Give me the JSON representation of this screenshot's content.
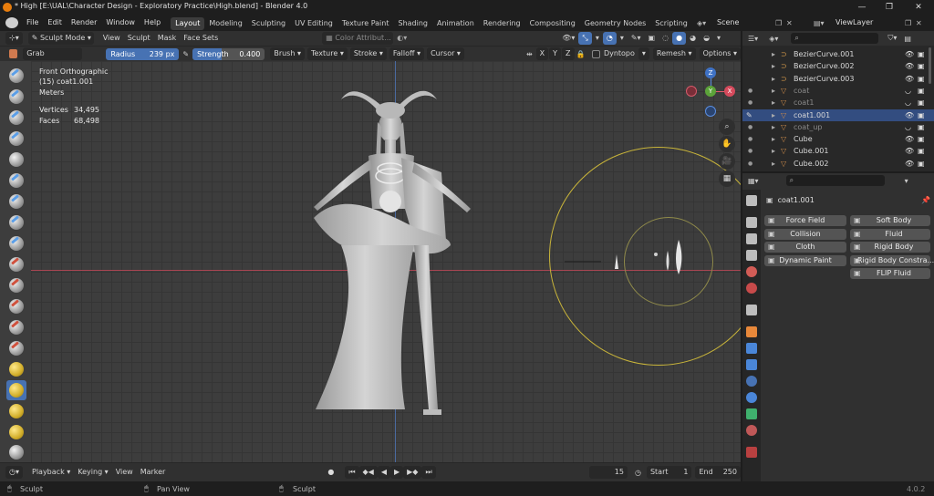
{
  "window": {
    "title": "* High [E:\\UAL\\Character Design - Exploratory Practice\\High.blend] - Blender 4.0",
    "minimize": "—",
    "maximize": "❐",
    "close": "✕"
  },
  "menu": [
    "File",
    "Edit",
    "Render",
    "Window",
    "Help"
  ],
  "workspaces": [
    "Layout",
    "Modeling",
    "Sculpting",
    "UV Editing",
    "Texture Paint",
    "Shading",
    "Animation",
    "Rendering",
    "Compositing",
    "Geometry Nodes",
    "Scripting"
  ],
  "active_workspace": "Layout",
  "scene": "Scene",
  "view_layer": "ViewLayer",
  "viewport_header": {
    "mode": "Sculpt Mode",
    "menus": [
      "View",
      "Sculpt",
      "Mask",
      "Face Sets"
    ],
    "color_attribute": "Color Attribut..."
  },
  "tool_settings": {
    "brush": "Grab",
    "radius_label": "Radius",
    "radius_value": "239 px",
    "strength_label": "Strength",
    "strength_value": "0.400",
    "menus": [
      "Brush",
      "Texture",
      "Stroke",
      "Falloff",
      "Cursor"
    ],
    "axes": [
      "X",
      "Y",
      "Z"
    ],
    "dyntopo": "Dyntopo",
    "remesh": "Remesh",
    "options": "Options"
  },
  "viewport_info": {
    "view": "Front Orthographic",
    "object": "(15) coat1.001",
    "units": "Meters",
    "vertices_label": "Vertices",
    "vertices_value": "34,495",
    "faces_label": "Faces",
    "faces_value": "68,498"
  },
  "gizmo": {
    "x": "X",
    "y": "Y",
    "z": "Z"
  },
  "outliner": {
    "rows": [
      {
        "name": "BezierCurve.001",
        "dim": false,
        "selected": false
      },
      {
        "name": "BezierCurve.002",
        "dim": false,
        "selected": false
      },
      {
        "name": "BezierCurve.003",
        "dim": false,
        "selected": false
      },
      {
        "name": "coat",
        "dim": true,
        "selected": false
      },
      {
        "name": "coat1",
        "dim": true,
        "selected": false
      },
      {
        "name": "coat1.001",
        "dim": false,
        "selected": true
      },
      {
        "name": "coat_up",
        "dim": true,
        "selected": false
      },
      {
        "name": "Cube",
        "dim": false,
        "selected": false
      },
      {
        "name": "Cube.001",
        "dim": false,
        "selected": false
      },
      {
        "name": "Cube.002",
        "dim": false,
        "selected": false
      }
    ]
  },
  "properties": {
    "object": "coat1.001",
    "physics_left": [
      "Force Field",
      "Collision",
      "Cloth",
      "Dynamic Paint"
    ],
    "physics_right": [
      "Soft Body",
      "Fluid",
      "Rigid Body",
      "Rigid Body Constra...",
      "FLIP Fluid"
    ]
  },
  "timeline": {
    "menus": [
      "Playback",
      "Keying",
      "View",
      "Marker"
    ],
    "current_frame": "15",
    "start_label": "Start",
    "start": "1",
    "end_label": "End",
    "end": "250"
  },
  "status": {
    "left": "Sculpt",
    "middle": "Pan View",
    "right": "Sculpt",
    "version": "4.0.2"
  }
}
